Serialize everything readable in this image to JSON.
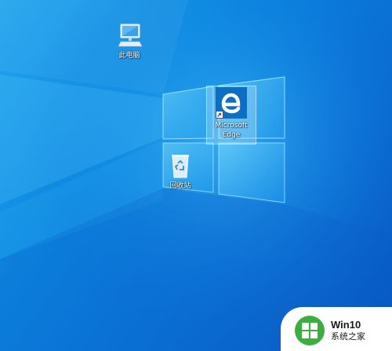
{
  "desktop": {
    "icons": [
      {
        "label": "此电脑",
        "icon": "computer-icon"
      },
      {
        "label": "Microsoft\nEdge",
        "icon": "edge-icon",
        "selected": true,
        "shortcut": true
      },
      {
        "label": "回收站",
        "icon": "recycle-bin-icon"
      }
    ]
  },
  "watermark": {
    "title": "Win10",
    "subtitle": "系统之家",
    "brand_color": "#3cae3e"
  },
  "colors": {
    "wallpaper_light": "#23a6ee",
    "wallpaper_dark": "#0755c0",
    "edge_blue": "#0c6fc4"
  }
}
